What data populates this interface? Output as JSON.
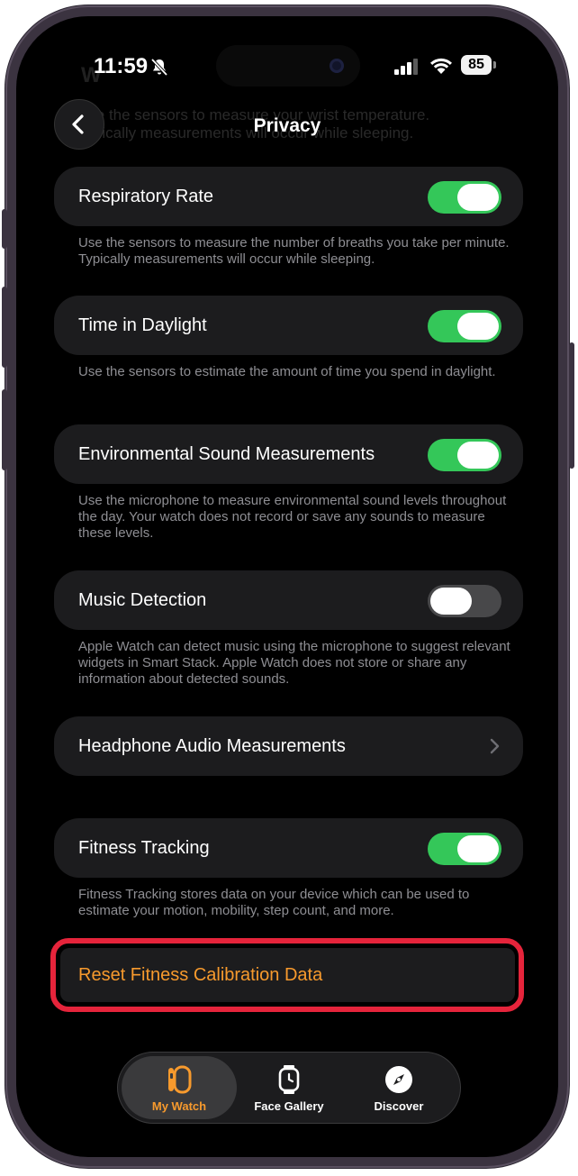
{
  "status_bar": {
    "time": "11:59",
    "battery": "85"
  },
  "background_hint": {
    "title": "W",
    "text": "Use the sensors to measure your wrist temperature. Typically measurements will occur while sleeping."
  },
  "nav": {
    "title": "Privacy"
  },
  "settings": [
    {
      "label": "Respiratory Rate",
      "toggle": "on",
      "description": "Use the sensors to measure the number of breaths you take per minute. Typically measurements will occur while sleeping."
    },
    {
      "label": "Time in Daylight",
      "toggle": "on",
      "description": "Use the sensors to estimate the amount of time you spend in daylight."
    },
    {
      "label": "Environmental Sound Measurements",
      "toggle": "on",
      "description": "Use the microphone to measure environmental sound levels throughout the day. Your watch does not record or save any sounds to measure these levels."
    },
    {
      "label": "Music Detection",
      "toggle": "off",
      "description": "Apple Watch can detect music using the microphone to suggest relevant widgets in Smart Stack. Apple Watch does not store or share any information about detected sounds."
    },
    {
      "label": "Headphone Audio Measurements"
    },
    {
      "label": "Fitness Tracking",
      "toggle": "on",
      "description": "Fitness Tracking stores data on your device which can be used to estimate your motion, mobility, step count, and more."
    }
  ],
  "reset": {
    "label": "Reset Fitness Calibration Data"
  },
  "tabs": [
    {
      "label": "My Watch",
      "icon": "watch-icon",
      "active": true
    },
    {
      "label": "Face Gallery",
      "icon": "watch-face-icon",
      "active": false
    },
    {
      "label": "Discover",
      "icon": "compass-icon",
      "active": false
    }
  ],
  "colors": {
    "accent": "#f79a2d",
    "toggle_on": "#34c759",
    "highlight": "#e5243b",
    "row_bg": "#1c1c1e"
  }
}
